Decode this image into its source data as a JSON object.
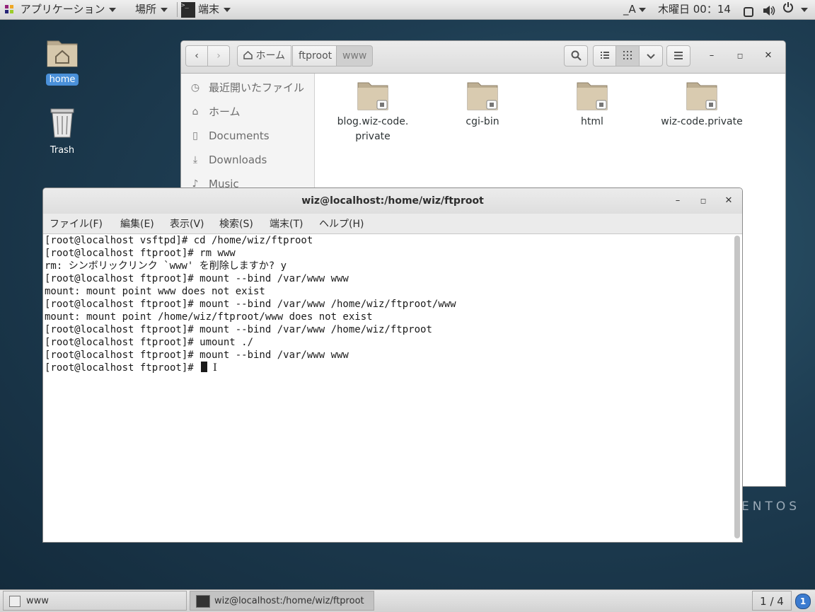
{
  "topbar": {
    "apps_label": "アプリケーション",
    "places_label": "場所",
    "terminal_label": "端末",
    "input_method": "_A",
    "clock": "木曜日 00：14"
  },
  "desktop": {
    "icons": [
      {
        "label": "home"
      },
      {
        "label": "Trash"
      }
    ]
  },
  "file_manager": {
    "breadcrumbs": [
      "ホーム",
      "ftproot",
      "www"
    ],
    "sidebar": [
      "最近開いたファイル",
      "ホーム",
      "Documents",
      "Downloads",
      "Music"
    ],
    "folders": [
      {
        "name_line1": "blog.wiz-code.",
        "name_line2": "private"
      },
      {
        "name_line1": "cgi-bin",
        "name_line2": ""
      },
      {
        "name_line1": "html",
        "name_line2": ""
      },
      {
        "name_line1": "wiz-code.private",
        "name_line2": ""
      }
    ]
  },
  "terminal": {
    "title": "wiz@localhost:/home/wiz/ftproot",
    "menu": [
      "ファイル(F)",
      "編集(E)",
      "表示(V)",
      "検索(S)",
      "端末(T)",
      "ヘルプ(H)"
    ],
    "lines": [
      "[root@localhost vsftpd]# cd /home/wiz/ftproot",
      "[root@localhost ftproot]# rm www",
      "rm: シンボリックリンク `www' を削除しますか? y",
      "[root@localhost ftproot]# mount --bind /var/www www",
      "mount: mount point www does not exist",
      "[root@localhost ftproot]# mount --bind /var/www /home/wiz/ftproot/www",
      "mount: mount point /home/wiz/ftproot/www does not exist",
      "[root@localhost ftproot]# mount --bind /var/www /home/wiz/ftproot",
      "[root@localhost ftproot]# umount ./",
      "[root@localhost ftproot]# mount --bind /var/www www"
    ],
    "prompt": "[root@localhost ftproot]# "
  },
  "background_text": "ENTOS",
  "taskbar": {
    "tasks": [
      "www",
      "wiz@localhost:/home/wiz/ftproot"
    ],
    "workspace": "1 / 4",
    "notification_count": "1"
  }
}
